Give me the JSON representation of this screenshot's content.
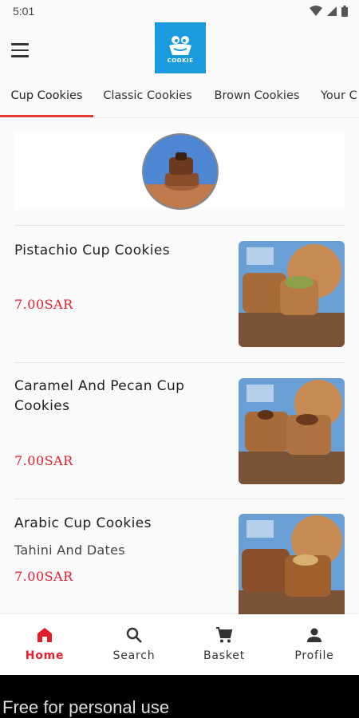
{
  "status_bar": {
    "time": "5:01"
  },
  "header": {
    "logo_text": "COOKIE"
  },
  "tabs": [
    {
      "label": "Cup Cookies",
      "active": true
    },
    {
      "label": "Classic Cookies",
      "active": false
    },
    {
      "label": "Brown Cookies",
      "active": false
    },
    {
      "label": "Your C",
      "active": false
    }
  ],
  "products": [
    {
      "name": "Pistachio Cup Cookies",
      "description": "",
      "price": "7.00SAR"
    },
    {
      "name": "Caramel And Pecan Cup Cookies",
      "description": "",
      "price": "7.00SAR"
    },
    {
      "name": "Arabic Cup Cookies",
      "description": "Tahini And Dates",
      "price": "7.00SAR"
    }
  ],
  "bottom_nav": [
    {
      "label": "Home",
      "icon": "home-icon",
      "active": true
    },
    {
      "label": "Search",
      "icon": "search-icon",
      "active": false
    },
    {
      "label": "Basket",
      "icon": "cart-icon",
      "active": false
    },
    {
      "label": "Profile",
      "icon": "person-icon",
      "active": false
    }
  ],
  "watermark": "Free for personal use",
  "colors": {
    "accent": "#e31e2d",
    "logo_bg": "#1a9be0",
    "tab_indicator": "#e53935"
  }
}
